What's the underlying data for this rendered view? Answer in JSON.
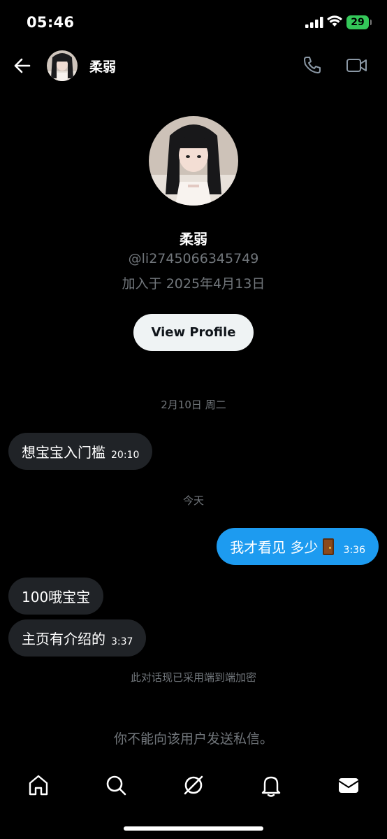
{
  "status_bar": {
    "time": "05:46",
    "battery": "29"
  },
  "header": {
    "name": "柔弱",
    "back_icon": "arrow-left-icon",
    "call_icon": "phone-icon",
    "video_icon": "video-camera-icon"
  },
  "profile": {
    "name": "柔弱",
    "handle": "@li2745066345749",
    "joined": "加入于 2025年4月13日",
    "view_profile_label": "View Profile"
  },
  "messages": {
    "date_1": "2月10日 周二",
    "msg_1": {
      "text": "想宝宝入门槛",
      "time": "20:10"
    },
    "date_2": "今天",
    "msg_2": {
      "text": "我才看见 多少",
      "time": "3:36",
      "emoji": "door-icon"
    },
    "msg_3": {
      "text": "100哦宝宝"
    },
    "msg_4": {
      "text": "主页有介绍的",
      "time": "3:37"
    }
  },
  "footer": {
    "e2e_note": "此对话现已采用端到端加密",
    "cannot_dm": "你不能向该用户发送私信。"
  },
  "tabs": [
    "home-icon",
    "search-icon",
    "grok-icon",
    "bell-icon",
    "mail-icon"
  ],
  "colors": {
    "background": "#000000",
    "incoming_bubble": "#202327",
    "outgoing_bubble": "#1d9bf0",
    "muted_text": "#71767b",
    "button_bg": "#eff3f4",
    "battery": "#34c759"
  }
}
